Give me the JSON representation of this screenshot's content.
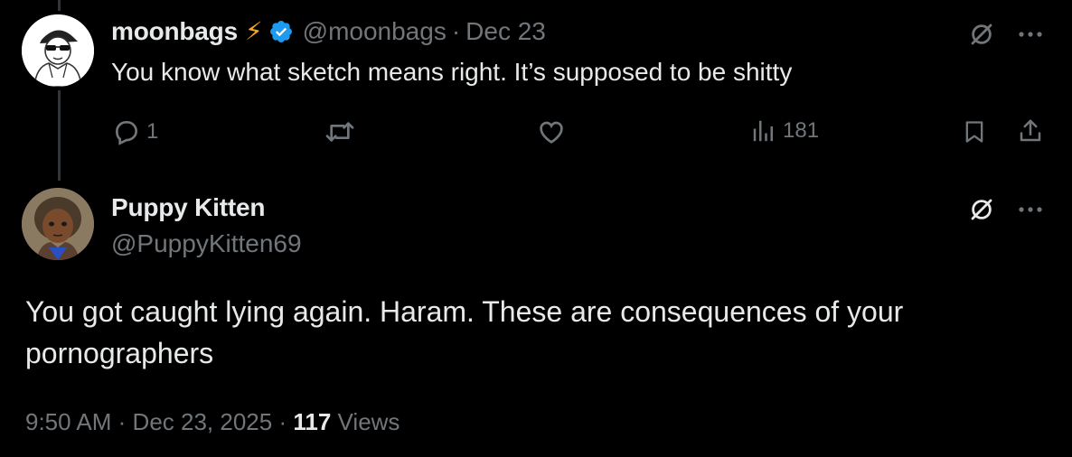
{
  "parent_tweet": {
    "display_name": "moonbags",
    "emoji": "⚡",
    "handle": "@moonbags",
    "separator": "·",
    "date": "Dec 23",
    "text": "You know what sketch means right. It’s supposed to be shitty",
    "actions": {
      "replies": "1",
      "views": "181"
    }
  },
  "main_tweet": {
    "display_name": "Puppy Kitten",
    "handle": "@PuppyKitten69",
    "text_line1": "You got caught lying again. Haram. These are consequences of your",
    "text_line2": "pornographers",
    "time": "9:50 AM",
    "sep1": "·",
    "date": "Dec 23, 2025",
    "sep2": "·",
    "views_count": "117",
    "views_label": "Views"
  },
  "colors": {
    "background": "#000000",
    "text": "#e7e9ea",
    "muted": "#71767b",
    "verified": "#1d9bf0",
    "lightning": "#f5a623",
    "thread_line": "#333639"
  },
  "icons": [
    "verified-badge-icon",
    "grok-icon",
    "more-icon",
    "reply-icon",
    "retweet-icon",
    "like-icon",
    "views-icon",
    "bookmark-icon",
    "share-icon"
  ]
}
